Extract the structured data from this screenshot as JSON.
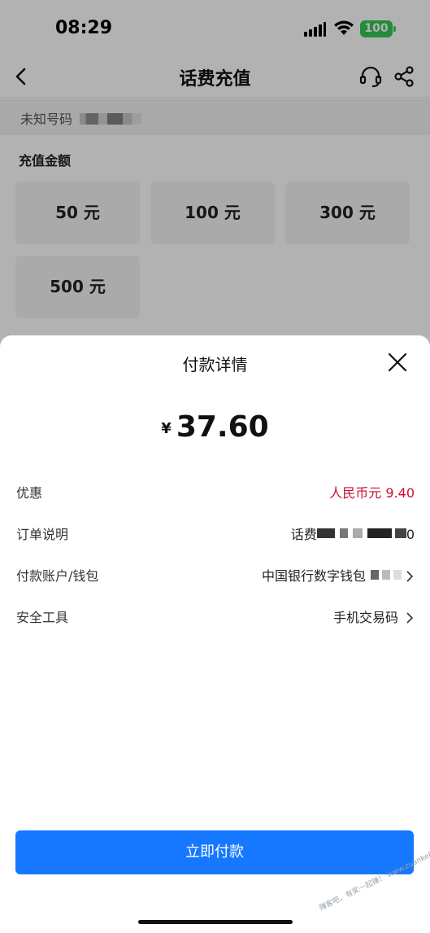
{
  "status_bar": {
    "time": "08:29",
    "battery": "100"
  },
  "nav": {
    "title": "话费充值"
  },
  "phone": {
    "label": "未知号码"
  },
  "recharge": {
    "title": "充值金额",
    "options": [
      "50 元",
      "100 元",
      "300 元",
      "500 元"
    ]
  },
  "sheet": {
    "title": "付款详情",
    "currency": "¥",
    "amount": "37.60",
    "rows": [
      {
        "label": "优惠",
        "value": "人民币元 9.40"
      },
      {
        "label": "订单说明",
        "value_prefix": "话费",
        "value_suffix": "0"
      },
      {
        "label": "付款账户/钱包",
        "value": "中国银行数字钱包"
      },
      {
        "label": "安全工具",
        "value": "手机交易码"
      }
    ],
    "pay_button": "立即付款"
  },
  "watermark": "赚客吧，有奖一起赚！ www.zuanke8.com",
  "colors": {
    "primary": "#1677ff",
    "discount": "#c8102e",
    "battery": "#34c759"
  },
  "icons": [
    "back-icon",
    "headset-icon",
    "share-icon",
    "close-icon",
    "chevron-right-icon",
    "wifi-icon",
    "signal-icon"
  ]
}
